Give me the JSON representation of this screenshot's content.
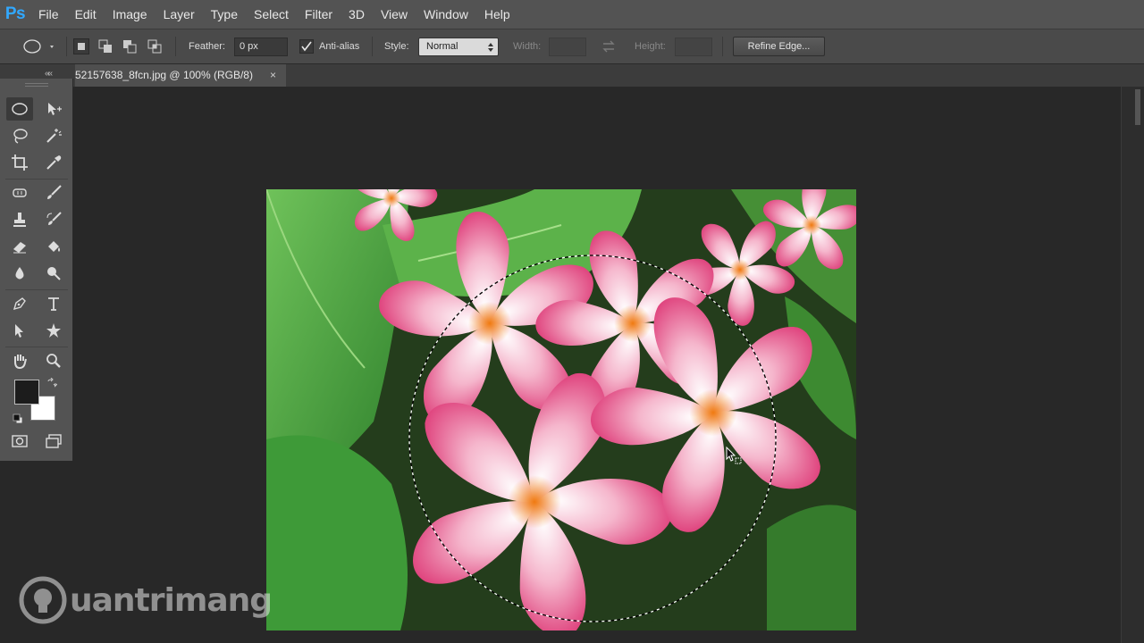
{
  "app": {
    "logo": "Ps"
  },
  "menu": [
    "File",
    "Edit",
    "Image",
    "Layer",
    "Type",
    "Select",
    "Filter",
    "3D",
    "View",
    "Window",
    "Help"
  ],
  "options": {
    "feather_label": "Feather:",
    "feather_value": "0 px",
    "antialias_label": "Anti-alias",
    "style_label": "Style:",
    "style_value": "Normal",
    "width_label": "Width:",
    "height_label": "Height:",
    "refine_label": "Refine Edge..."
  },
  "document": {
    "tab_title": "52157638_8fcn.jpg @ 100% (RGB/8)",
    "close_glyph": "×",
    "collapse_glyph": "««"
  },
  "watermark": {
    "text": "uantrimang"
  },
  "colors": {
    "foreground": "#1c1c1c",
    "background": "#ffffff",
    "accent": "#31a8ff"
  }
}
